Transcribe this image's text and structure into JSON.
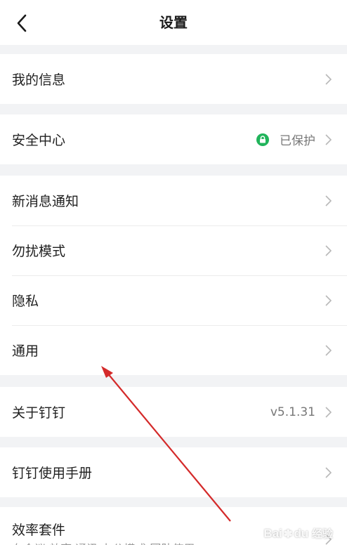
{
  "header": {
    "title": "设置"
  },
  "groups": {
    "my_info": {
      "label": "我的信息"
    },
    "security": {
      "label": "安全中心",
      "status": "已保护",
      "status_color": "#21b45b"
    },
    "notifications": {
      "new_message": "新消息通知",
      "dnd": "勿扰模式",
      "privacy": "隐私",
      "general": "通用"
    },
    "about": {
      "label": "关于钉钉",
      "version": "v5.1.31"
    },
    "manual": {
      "label": "钉钉使用手册"
    },
    "efficiency": {
      "label": "效率套件",
      "subtitle": "在会议 效率 通讯 办公模式 团队使用"
    }
  },
  "watermark": {
    "brand": "Bai",
    "brand2": "du",
    "suffix": "经验"
  },
  "colors": {
    "accent": "#21b45b",
    "annotation_arrow": "#d42a2a",
    "background": "#f2f3f5"
  }
}
